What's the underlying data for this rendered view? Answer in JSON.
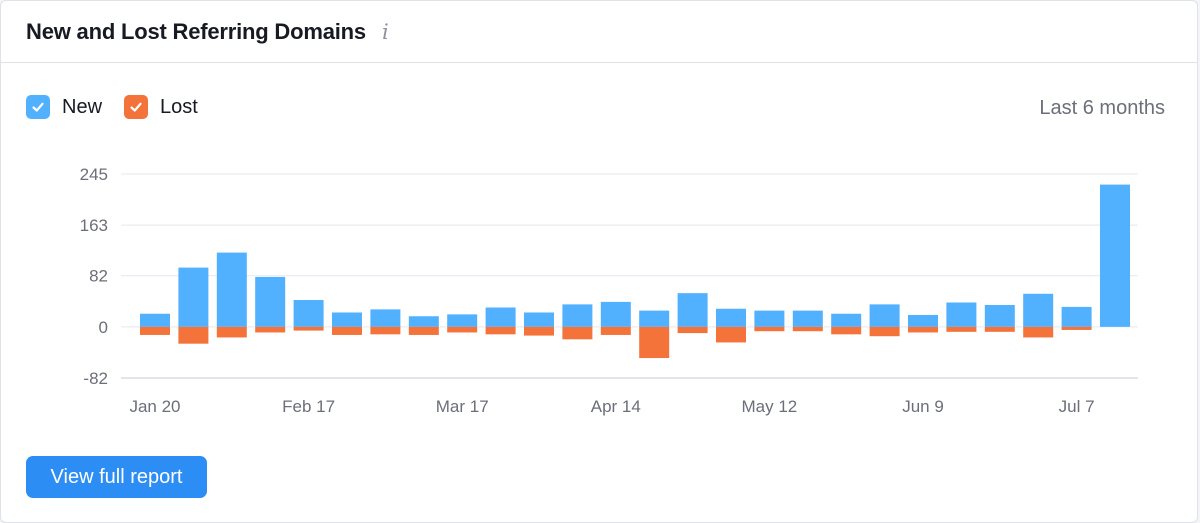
{
  "widget": {
    "title": "New and Lost Referring Domains",
    "info_icon": "info-icon",
    "range_label": "Last 6 months",
    "cta_label": "View full report"
  },
  "legend": {
    "items": [
      {
        "label": "New",
        "color": "#52b1ff",
        "checked": true
      },
      {
        "label": "Lost",
        "color": "#f3733b",
        "checked": true
      }
    ]
  },
  "chart_data": {
    "type": "bar",
    "stacking": "diverging",
    "yticks": [
      245,
      163,
      82,
      0,
      -82
    ],
    "ylim": [
      -82,
      245
    ],
    "grid": true,
    "legend_position": "top-left",
    "xtick_labels": [
      {
        "label": "Jan 20",
        "index": 0
      },
      {
        "label": "Feb 17",
        "index": 4
      },
      {
        "label": "Mar 17",
        "index": 8
      },
      {
        "label": "Apr 14",
        "index": 12
      },
      {
        "label": "May 12",
        "index": 16
      },
      {
        "label": "Jun 9",
        "index": 20
      },
      {
        "label": "Jul 7",
        "index": 24
      }
    ],
    "series": [
      {
        "name": "New",
        "color": "#52b1ff",
        "values": [
          21,
          95,
          119,
          80,
          43,
          23,
          28,
          17,
          20,
          31,
          23,
          36,
          40,
          26,
          54,
          29,
          26,
          26,
          21,
          36,
          19,
          39,
          35,
          53,
          32,
          228
        ]
      },
      {
        "name": "Lost",
        "color": "#f3733b",
        "values": [
          -13,
          -27,
          -17,
          -9,
          -6,
          -13,
          -12,
          -13,
          -9,
          -12,
          -14,
          -20,
          -13,
          -50,
          -10,
          -25,
          -7,
          -7,
          -12,
          -15,
          -9,
          -8,
          -8,
          -17,
          -5,
          0
        ]
      }
    ]
  }
}
